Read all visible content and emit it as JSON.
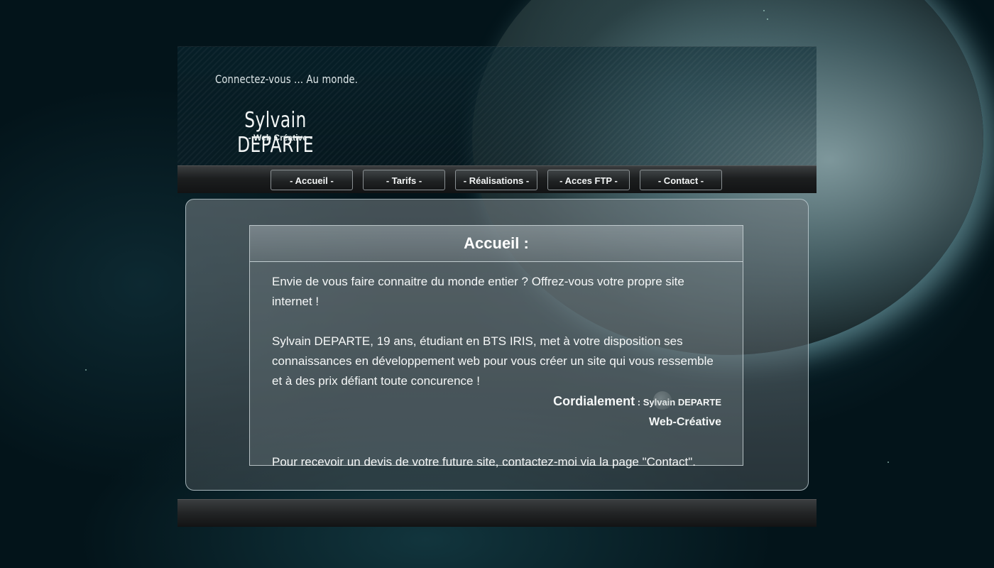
{
  "header": {
    "tagline": "Connectez-vous ... Au monde.",
    "brand_name": "Sylvain DEPARTE",
    "brand_sub": "- Web Créative -"
  },
  "nav": {
    "items": [
      {
        "label": "- Accueil -"
      },
      {
        "label": "- Tarifs -"
      },
      {
        "label": "- Réalisations -"
      },
      {
        "label": "- Acces FTP -"
      },
      {
        "label": "- Contact -"
      }
    ]
  },
  "article": {
    "title": "Accueil :",
    "paragraph1": "Envie de vous faire connaitre du monde entier ? Offrez-vous votre propre site internet !",
    "paragraph2": "Sylvain DEPARTE, 19 ans, étudiant en BTS IRIS, met à votre disposition ses connaissances en développement web pour vous créer un site qui vous  ressemble et à des prix défiant toute concurence !",
    "sign_word": "Cordialement",
    "sign_name": " : Sylvain DEPARTE",
    "sign_line2": "Web-Créative",
    "paragraph3": "Pour recevoir un devis de votre future site, contactez-moi via la page \"Contact\"."
  },
  "colors": {
    "background": "#03141a",
    "nav_border": "#8a9093",
    "text": "#f5f7f7"
  }
}
